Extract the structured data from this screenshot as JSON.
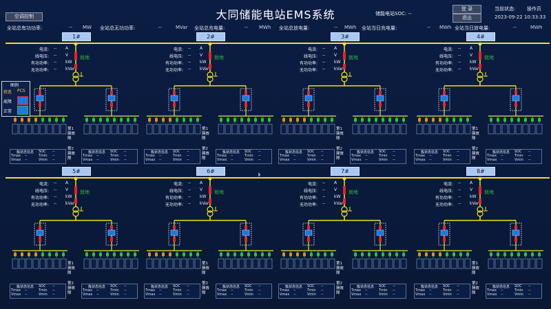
{
  "header": {
    "left_button": "空调控制",
    "title": "大同储能电站EMS系统",
    "soc_label": "储能电站SOC:",
    "soc_value": "--",
    "login": "登 录",
    "logout": "退出",
    "current_status_label": "当前状态:",
    "operator_label": "操作员",
    "datetime": "2023-09-22 10:33:33"
  },
  "stats": [
    {
      "label": "全站总有功功率:",
      "value": "--",
      "unit": "MW"
    },
    {
      "label": "全站总无功功率:",
      "value": "--",
      "unit": "MVar"
    },
    {
      "label": "全站总充电量:",
      "value": "--",
      "unit": "MWh"
    },
    {
      "label": "全站总放电量:",
      "value": "--",
      "unit": "MWh"
    },
    {
      "label": "全站当日充电量:",
      "value": "--",
      "unit": "MWh"
    },
    {
      "label": "全站当日放电量:",
      "value": "--",
      "unit": "MWh"
    }
  ],
  "legend": {
    "title": "图例",
    "col1": "状态",
    "col2": "PCS",
    "fault": "故障",
    "normal": "正常"
  },
  "units": [
    {
      "id": "1#"
    },
    {
      "id": "2#"
    },
    {
      "id": "3#"
    },
    {
      "id": "4#"
    },
    {
      "id": "5#"
    },
    {
      "id": "6#"
    },
    {
      "id": "7#"
    },
    {
      "id": "8#"
    }
  ],
  "unit_params": {
    "current": "电流:",
    "line_voltage": "线电压:",
    "active_power": "有功功率:",
    "reactive_power": "无功功率:",
    "v": "--",
    "unit_a": "A",
    "unit_v": "V",
    "unit_kw": "kW",
    "unit_kvar": "kVar",
    "local_label": "就地"
  },
  "cluster": {
    "fault1": "第1簇故障",
    "fault2": "第2簇故障",
    "info_title": "簇状态信息",
    "soc": "SOC",
    "tmax": "Tmax",
    "tmin": "Tmin",
    "vmax": "Vmax",
    "vmin": "Vmin",
    "dash": "--"
  },
  "colors": {
    "bus": "#f2e21a",
    "breaker_red": "#e8222a",
    "pcs_blue": "#1e78e0",
    "battery_green": "#2ebd3e",
    "battery_orange": "#e88a1a"
  }
}
